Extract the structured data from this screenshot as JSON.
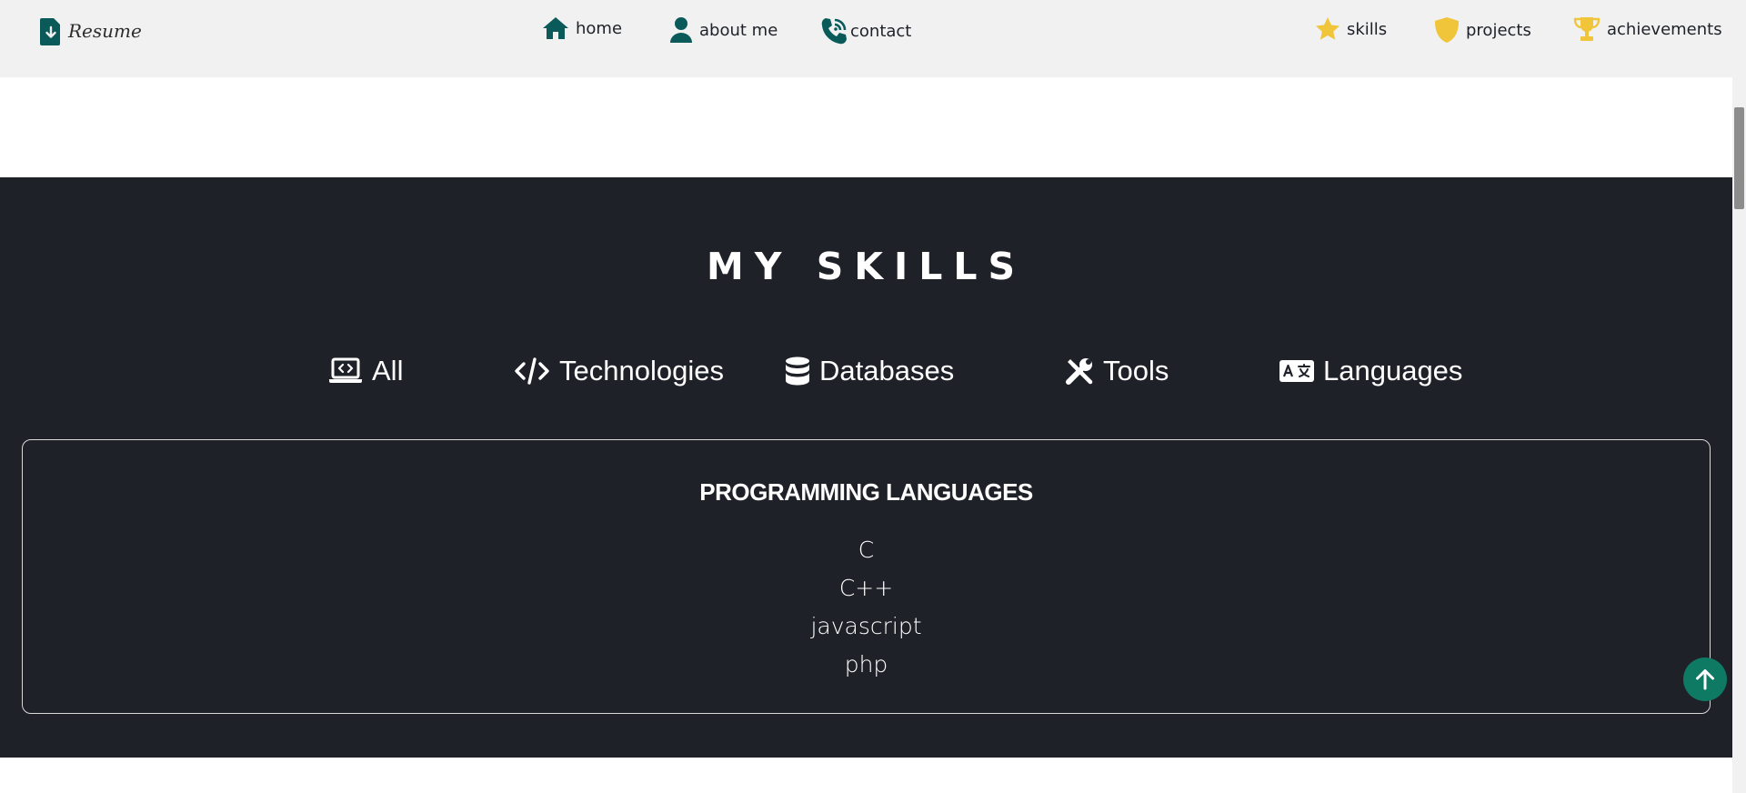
{
  "nav": {
    "resume_label": "Resume",
    "home_label": "home",
    "about_label": "about me",
    "contact_label": "contact",
    "skills_label": "skills",
    "projects_label": "projects",
    "achievements_label": "achievements",
    "icons": {
      "resume": "file-download-icon",
      "home": "home-icon",
      "about": "user-icon",
      "contact": "phone-icon",
      "skills": "star-icon",
      "projects": "shield-icon",
      "achievements": "trophy-icon"
    },
    "colors": {
      "dark_icon": "#0b5a5a",
      "gold_icon": "#f0c53a",
      "bar_bg": "#f1f1f1"
    }
  },
  "skills_section": {
    "title": "MY SKILLS",
    "filters": [
      {
        "label": "All",
        "icon": "laptop-code-icon"
      },
      {
        "label": "Technologies",
        "icon": "code-icon"
      },
      {
        "label": "Databases",
        "icon": "database-icon"
      },
      {
        "label": "Tools",
        "icon": "tools-icon"
      },
      {
        "label": "Languages",
        "icon": "language-icon"
      }
    ],
    "card": {
      "title": "PROGRAMMING LANGUAGES",
      "items": [
        "C",
        "C++",
        "javascript",
        "php"
      ]
    },
    "colors": {
      "background": "#1f2128",
      "text": "#ffffff"
    }
  },
  "scroll_top": {
    "icon": "arrow-up-icon",
    "color": "#0e7a64"
  }
}
